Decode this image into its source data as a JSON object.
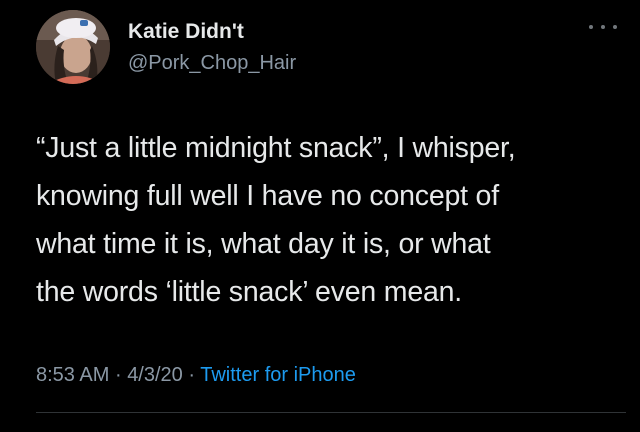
{
  "user": {
    "display_name": "Katie Didn't",
    "handle": "@Pork_Chop_Hair",
    "avatar_icon": "profile-photo"
  },
  "tweet": {
    "lines": [
      "“Just a little midnight snack”, I whisper,",
      "knowing full well I have no concept of",
      "what time it is, what day it is, or what",
      "the words ‘little snack’ even mean."
    ],
    "time": "8:53 AM",
    "separator": "·",
    "date": "4/3/20",
    "source": "Twitter for iPhone"
  },
  "colors": {
    "background": "#000000",
    "text": "#e7e9ea",
    "secondary_text": "#8b98a5",
    "link": "#1d9bf0"
  }
}
